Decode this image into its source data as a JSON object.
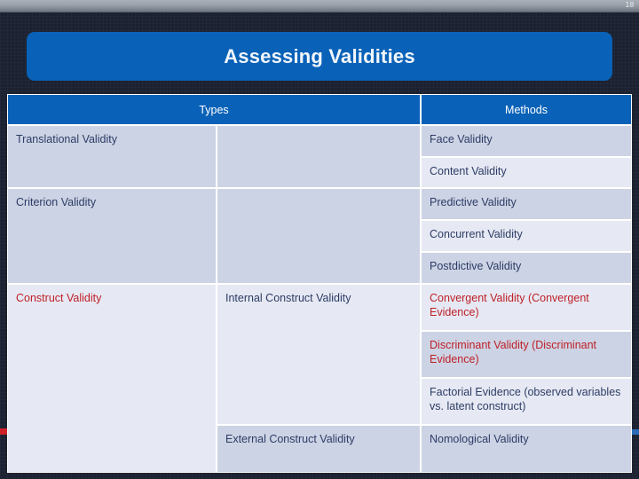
{
  "slide": {
    "page_number": "18",
    "title": "Assessing Validities",
    "accent_red": "#cf2026",
    "accent_blue": "#2b6cb8",
    "banner_color": "#0a62b8",
    "text_color": "#2d3c66",
    "highlight_color": "#bf1f27",
    "row_color_a": "#ccd3e4",
    "row_color_b": "#e6e9f3"
  },
  "table": {
    "headers": {
      "types": "Types",
      "methods": "Methods"
    },
    "rows": [
      {
        "type": "Translational Validity",
        "subtype": "",
        "method": "Face Validity"
      },
      {
        "type": "",
        "subtype": "",
        "method": "Content Validity"
      },
      {
        "type": "Criterion Validity",
        "subtype": "",
        "method": "Predictive Validity"
      },
      {
        "type": "",
        "subtype": "",
        "method": "Concurrent Validity"
      },
      {
        "type": "",
        "subtype": "",
        "method": "Postdictive Validity"
      },
      {
        "type": "Construct Validity",
        "subtype": "Internal Construct Validity",
        "method": "Convergent Validity (Convergent Evidence)"
      },
      {
        "type": "",
        "subtype": "",
        "method": "Discriminant Validity (Discriminant Evidence)"
      },
      {
        "type": "",
        "subtype": "",
        "method": "Factorial Evidence (observed variables vs. latent construct)"
      },
      {
        "type": "",
        "subtype": "External Construct Validity",
        "method": "Nomological Validity"
      }
    ]
  }
}
